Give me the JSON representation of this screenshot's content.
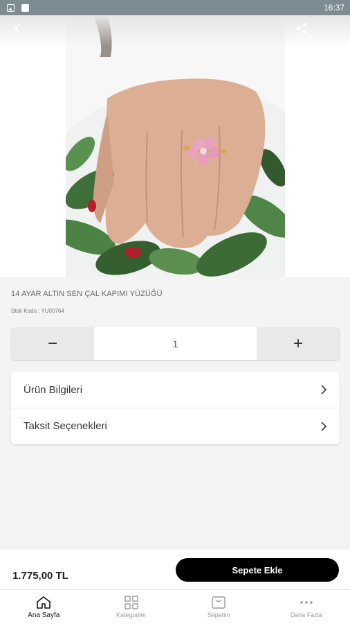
{
  "status_bar": {
    "time": "16:37"
  },
  "product": {
    "title": "14 AYAR ALTIN SEN ÇAL KAPIMI YÜZÜĞÜ",
    "stock_code": "Stok Kodu : YU00764"
  },
  "quantity": {
    "decrease": "−",
    "value": "1",
    "increase": "+"
  },
  "info": {
    "product_info": "Ürün Bilgileri",
    "installments": "Taksit Seçenekleri"
  },
  "purchase": {
    "price": "1.775,00 TL",
    "add_to_cart": "Sepete Ekle"
  },
  "tabs": [
    {
      "label": "Ana Sayfa",
      "icon": "home-icon"
    },
    {
      "label": "Kategoriler",
      "icon": "grid-icon"
    },
    {
      "label": "Sepetim",
      "icon": "basket-icon"
    },
    {
      "label": "Daha Fazla",
      "icon": "more-icon"
    }
  ],
  "colors": {
    "status_bar": "#7d8b92",
    "cart_button": "#000000",
    "background": "#f4f4f4"
  }
}
